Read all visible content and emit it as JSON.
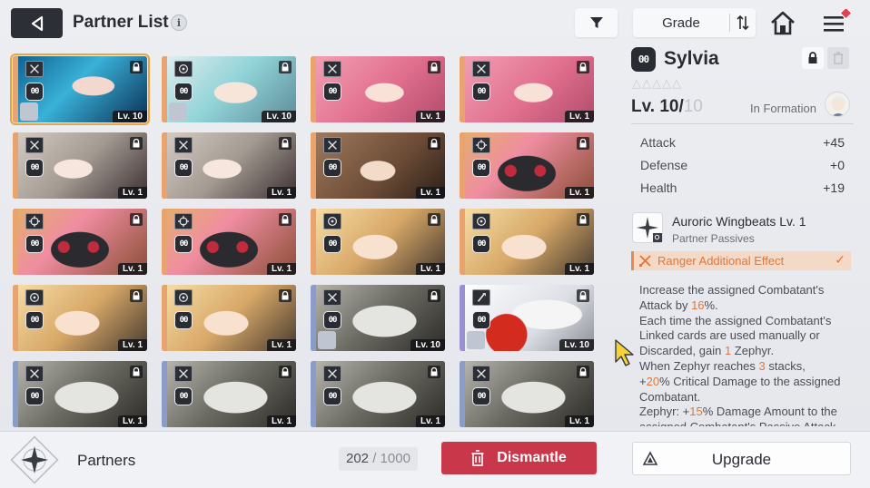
{
  "header": {
    "title": "Partner List",
    "info_glyph": "i",
    "sort_label": "Grade"
  },
  "grid": {
    "cards": [
      {
        "level": "Lv. 10",
        "art": "blue",
        "class_icon": "crossed-swords-icon",
        "selected": true,
        "mini": true
      },
      {
        "level": "Lv. 10",
        "art": "teal",
        "class_icon": "compass-icon",
        "selected": false,
        "mini": true
      },
      {
        "level": "Lv. 1",
        "art": "pink",
        "class_icon": "crossed-swords-icon",
        "selected": false,
        "mini": false
      },
      {
        "level": "Lv. 1",
        "art": "pink",
        "class_icon": "crossed-swords-icon",
        "selected": false,
        "mini": false
      },
      {
        "level": "Lv. 1",
        "art": "silver",
        "class_icon": "crossed-swords-icon",
        "selected": false,
        "mini": false
      },
      {
        "level": "Lv. 1",
        "art": "silver",
        "class_icon": "crossed-swords-icon",
        "selected": false,
        "mini": false
      },
      {
        "level": "Lv. 1",
        "art": "brown",
        "class_icon": "crossed-swords-icon",
        "selected": false,
        "mini": false
      },
      {
        "level": "Lv. 1",
        "art": "black-creature",
        "class_icon": "crosshair-icon",
        "selected": false,
        "mini": false
      },
      {
        "level": "Lv. 1",
        "art": "black-creature",
        "class_icon": "crosshair-icon",
        "selected": false,
        "mini": false
      },
      {
        "level": "Lv. 1",
        "art": "black-creature",
        "class_icon": "crosshair-icon",
        "selected": false,
        "mini": false
      },
      {
        "level": "Lv. 1",
        "art": "blonde",
        "class_icon": "compass-icon",
        "selected": false,
        "mini": false
      },
      {
        "level": "Lv. 1",
        "art": "blonde",
        "class_icon": "compass-icon",
        "selected": false,
        "mini": false
      },
      {
        "level": "Lv. 1",
        "art": "blonde",
        "class_icon": "compass-icon",
        "selected": false,
        "mini": false
      },
      {
        "level": "Lv. 1",
        "art": "blonde",
        "class_icon": "compass-icon",
        "selected": false,
        "mini": false
      },
      {
        "level": "Lv. 10",
        "art": "walrus",
        "class_icon": "crossed-swords-icon",
        "selected": false,
        "mini": true
      },
      {
        "level": "Lv. 10",
        "art": "white-wolf",
        "class_icon": "slash-icon",
        "selected": false,
        "mini": true
      },
      {
        "level": "Lv. 1",
        "art": "walrus",
        "class_icon": "crossed-swords-icon",
        "selected": false,
        "mini": false
      },
      {
        "level": "Lv. 1",
        "art": "walrus",
        "class_icon": "crossed-swords-icon",
        "selected": false,
        "mini": false
      },
      {
        "level": "Lv. 1",
        "art": "walrus",
        "class_icon": "crossed-swords-icon",
        "selected": false,
        "mini": false
      },
      {
        "level": "Lv. 1",
        "art": "walrus",
        "class_icon": "crossed-swords-icon",
        "selected": false,
        "mini": false
      }
    ],
    "emblem_text": "00"
  },
  "detail": {
    "emblem_text": "00",
    "name": "Sylvia",
    "stars": "△△△△△",
    "level": "Lv. 10/",
    "level_max": "10",
    "formation": "In Formation",
    "stats": [
      {
        "label": "Attack",
        "value": "+45"
      },
      {
        "label": "Defense",
        "value": "+0"
      },
      {
        "label": "Health",
        "value": "+19"
      }
    ],
    "passive_name": "Auroric Wingbeats Lv. 1",
    "passive_sub": "Partner Passives",
    "ranger_label": "Ranger Additional Effect",
    "ranger_check": "✓",
    "desc": {
      "p1a": "Increase the assigned Combatant's Attack by ",
      "p1v": "16",
      "p1b": "%.",
      "p2a": "Each time the assigned Combatant's Linked cards are used manually or Discarded, gain ",
      "p2v": "1",
      "p2b": " Zephyr.",
      "p3a": "When Zephyr reaches ",
      "p3v": "3",
      "p3b": " stacks,",
      "p4a": "+",
      "p4v": "20",
      "p4b": "% Critical Damage to the assigned Combatant.",
      "p5a": "Zephyr: +",
      "p5v": "15",
      "p5b": "% Damage Amount to the assigned Combatant's Passive Attack"
    }
  },
  "footer": {
    "label": "Partners",
    "count": "202",
    "count_sep": " / ",
    "count_max": "1000",
    "dismantle": "Dismantle",
    "upgrade": "Upgrade"
  },
  "colors": {
    "accent_orange": "#e0773a",
    "dismantle_red": "#c8384a",
    "selected_outline": "#f0a23a"
  }
}
